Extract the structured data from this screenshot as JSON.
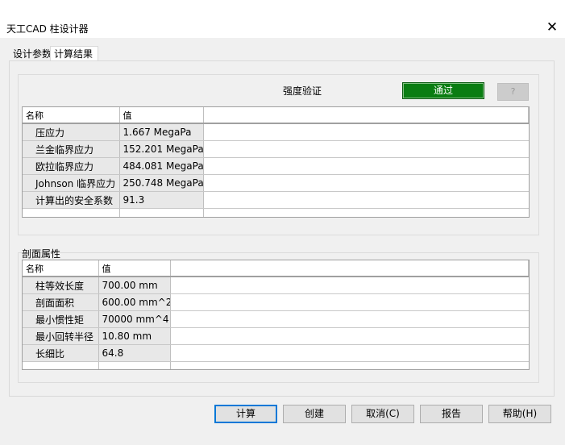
{
  "window": {
    "title": "天工CAD 柱设计器",
    "close": "✕"
  },
  "tabs": [
    {
      "label": "设计参数"
    },
    {
      "label": "计算结果"
    }
  ],
  "strength": {
    "label": "强度验证",
    "status": "通过",
    "help": "?",
    "status_color": "#0a7d12"
  },
  "results_table": {
    "headers": [
      "名称",
      "值"
    ],
    "rows": [
      {
        "name": "压应力",
        "value": "1.667 MegaPa"
      },
      {
        "name": "兰金临界应力",
        "value": "152.201 MegaPa"
      },
      {
        "name": "欧拉临界应力",
        "value": "484.081 MegaPa"
      },
      {
        "name": "Johnson 临界应力",
        "value": "250.748 MegaPa"
      },
      {
        "name": "计算出的安全系数",
        "value": "91.3"
      }
    ]
  },
  "section": {
    "label": "剖面属性",
    "headers": [
      "名称",
      "值"
    ],
    "rows": [
      {
        "name": "柱等效长度",
        "value": "700.00 mm"
      },
      {
        "name": "剖面面积",
        "value": "600.00 mm^2"
      },
      {
        "name": "最小惯性矩",
        "value": "70000 mm^4"
      },
      {
        "name": "最小回转半径",
        "value": "10.80 mm"
      },
      {
        "name": "长细比",
        "value": "64.8"
      }
    ]
  },
  "buttons": {
    "calc": "计算",
    "create": "创建",
    "cancel": "取消(C)",
    "report": "报告",
    "help": "帮助(H)"
  }
}
